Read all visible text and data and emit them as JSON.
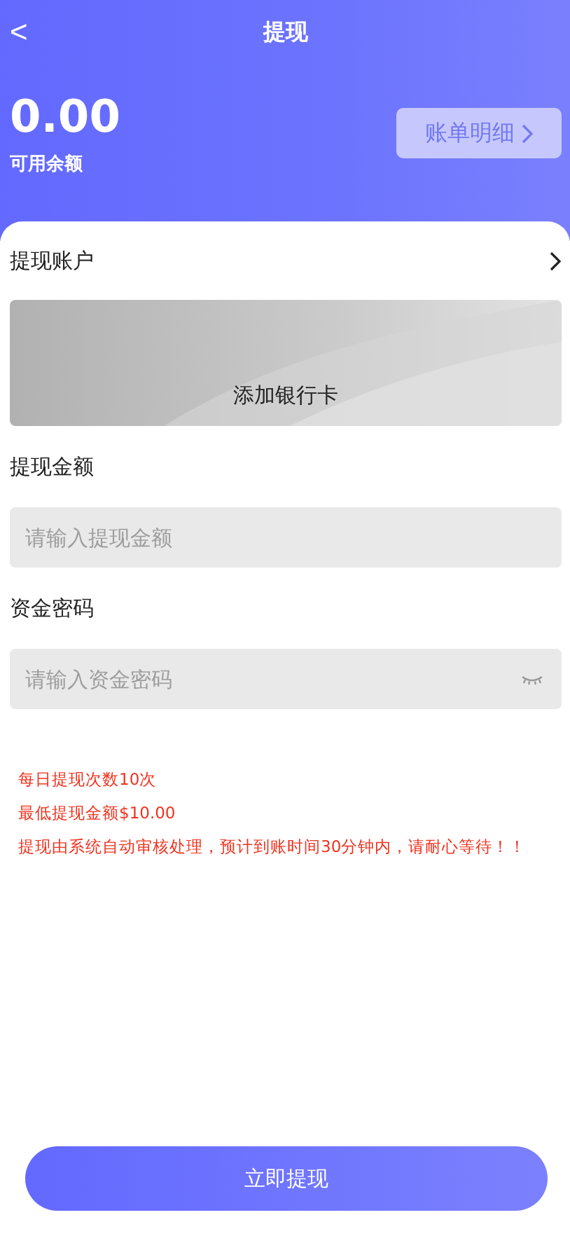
{
  "header": {
    "back": "<",
    "title": "提现"
  },
  "balance": {
    "amount": "0.00",
    "label": "可用余额",
    "details_button": "账单明细"
  },
  "account": {
    "label": "提现账户",
    "card_text": "添加银行卡"
  },
  "fields": [
    {
      "label": "提现金额",
      "placeholder": "请输入提现金额",
      "kind": "amount"
    },
    {
      "label": "资金密码",
      "placeholder": "请输入资金密码",
      "kind": "password"
    }
  ],
  "notes": [
    "每日提现次数10次",
    "最低提现金额$10.00",
    "提现由系统自动审核处理，预计到账时间30分钟内，请耐心等待！！"
  ],
  "submit": "立即提现"
}
